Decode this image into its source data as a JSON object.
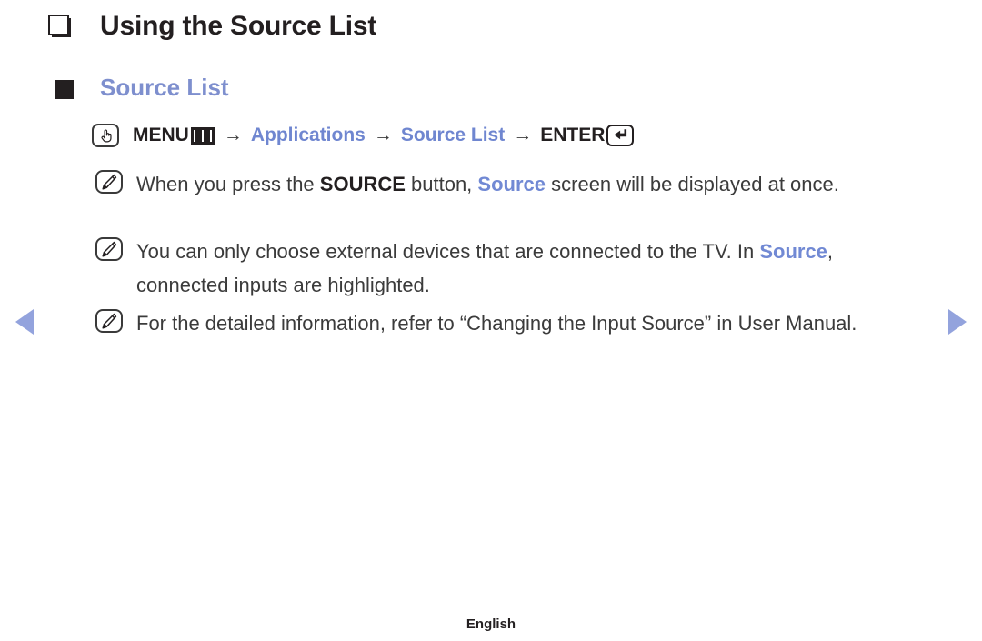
{
  "page": {
    "title": "Using the Source List",
    "title_bullet_icon": "hollow-square-bullet-icon",
    "section": {
      "label": "Source List",
      "bullet_icon": "filled-square-bullet-icon",
      "accent_color": "#7e8fce"
    },
    "menu_path": {
      "hand_icon": "pointing-hand-icon",
      "menu_label": "MENU",
      "menu_glyph_icon": "menu-grid-icon",
      "arrow_1": "→",
      "applications_label": "Applications",
      "arrow_2": "→",
      "source_list_label": "Source List",
      "arrow_3": "→",
      "enter_label": "ENTER",
      "enter_glyph_icon": "enter-return-icon",
      "blue_color": "#6f86d0"
    },
    "notes": [
      {
        "icon": "note-pencil-icon",
        "parts": [
          {
            "text": "When you press the ",
            "style": "normal"
          },
          {
            "text": "SOURCE",
            "style": "bold"
          },
          {
            "text": " button, ",
            "style": "normal"
          },
          {
            "text": "Source",
            "style": "blue"
          },
          {
            "text": " screen will be displayed at once.",
            "style": "normal"
          }
        ]
      },
      {
        "icon": "note-pencil-icon",
        "parts": [
          {
            "text": "You can only choose external devices that are connected to the TV. In ",
            "style": "normal"
          },
          {
            "text": "Source",
            "style": "blue"
          },
          {
            "text": ", connected inputs are highlighted.",
            "style": "normal"
          }
        ]
      },
      {
        "icon": "note-pencil-icon",
        "parts": [
          {
            "text": "For the detailed information, refer to “Changing the Input Source” in User Manual.",
            "style": "normal"
          }
        ]
      }
    ],
    "nav": {
      "prev_icon": "triangle-left-icon",
      "next_icon": "triangle-right-icon",
      "arrow_color": "#93a3dd"
    },
    "footer": {
      "language": "English"
    }
  }
}
